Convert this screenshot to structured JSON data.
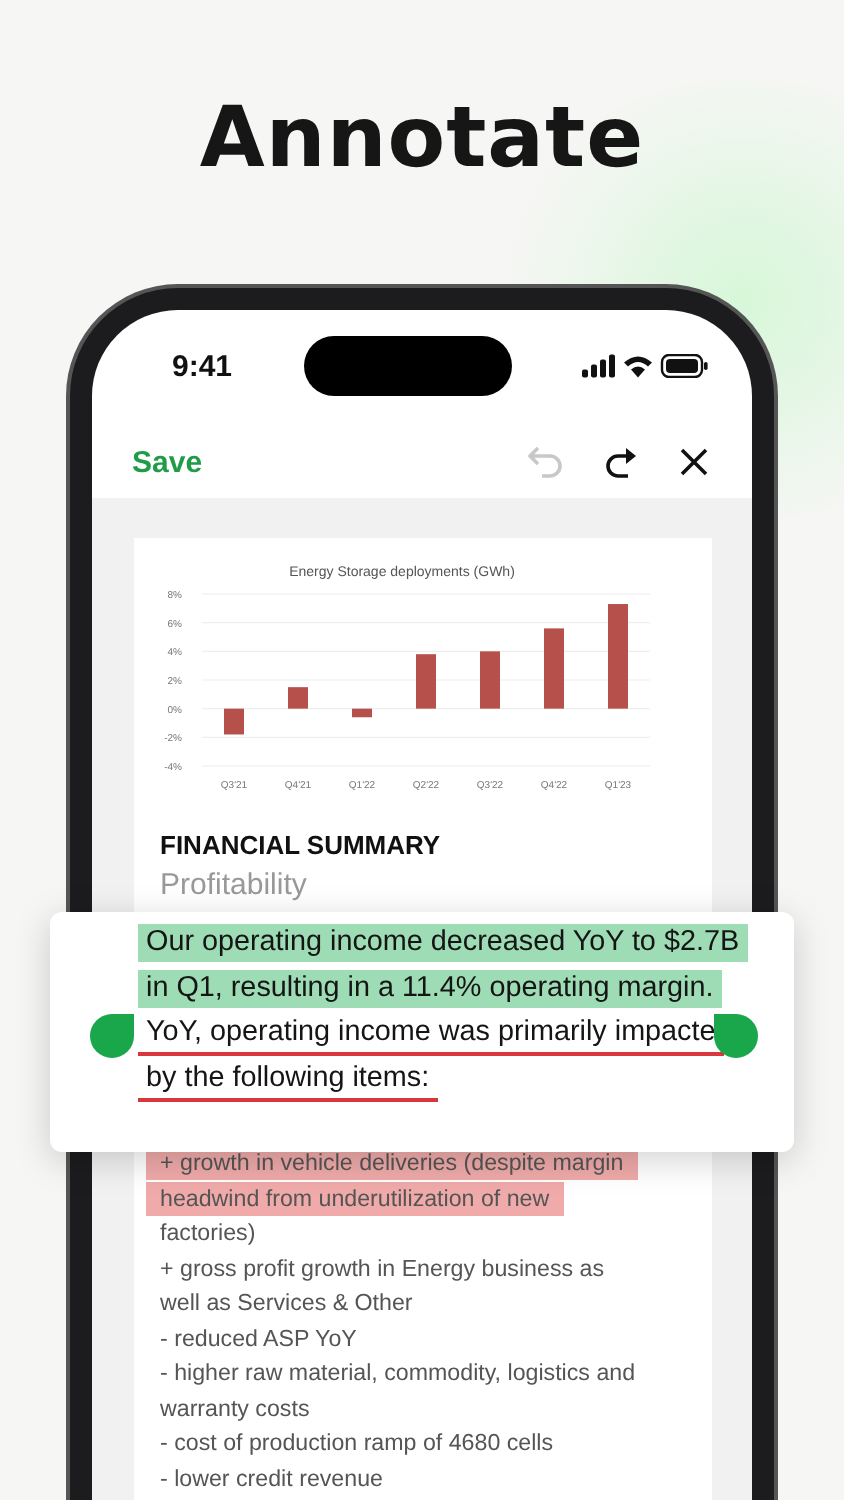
{
  "heading": "Annotate",
  "status_bar": {
    "time": "9:41"
  },
  "toolbar": {
    "save": "Save",
    "undo_disabled": true,
    "redo_disabled": false
  },
  "document": {
    "chart_data": {
      "type": "bar",
      "title": "Energy Storage deployments (GWh)",
      "categories": [
        "Q3'21",
        "Q4'21",
        "Q1'22",
        "Q2'22",
        "Q3'22",
        "Q4'22",
        "Q1'23"
      ],
      "grid": true,
      "series": [
        {
          "color": "#b5504b",
          "values": [
            -1.8,
            1.5,
            -0.6,
            3.8,
            4.0,
            5.6,
            7.3
          ]
        }
      ],
      "ylim": [
        -4,
        8
      ],
      "yticks": [
        {
          "value": 8,
          "label": "8%"
        },
        {
          "value": 6,
          "label": "6%"
        },
        {
          "value": 4,
          "label": "4%"
        },
        {
          "value": 2,
          "label": "2%"
        },
        {
          "value": 0,
          "label": "0%"
        },
        {
          "value": -2,
          "label": "-2%"
        },
        {
          "value": -4,
          "label": "-4%"
        }
      ]
    },
    "section_title": "FINANCIAL SUMMARY",
    "subtitle": "Profitability",
    "popup_lines": [
      {
        "text": "Our operating income decreased YoY to $2.7B",
        "kind": "highlight",
        "color": "#9ddcb5"
      },
      {
        "text": "in Q1, resulting in a 11.4% operating margin.",
        "kind": "highlight",
        "color": "#9ddcb5"
      },
      {
        "text": "YoY, operating income was primarily impacte",
        "kind": "underline",
        "color": "#d9363e"
      },
      {
        "text": "by the following items:",
        "kind": "underline",
        "color": "#d9363e"
      }
    ],
    "lines": [
      {
        "text": "+ growth in vehicle deliveries (despite margin",
        "kind": "highlight",
        "color": "#efaaa9"
      },
      {
        "text": "headwind from underutilization of new",
        "kind": "highlight",
        "color": "#efaaa9"
      },
      {
        "text": "factories)",
        "kind": "plain"
      },
      {
        "text": "+ gross profit growth in Energy business as",
        "kind": "plain"
      },
      {
        "text": "well as Services & Other",
        "kind": "plain"
      },
      {
        "text": "- reduced ASP YoY",
        "kind": "plain"
      },
      {
        "text": "- higher raw material, commodity, logistics and",
        "kind": "plain"
      },
      {
        "text": "warranty costs",
        "kind": "plain"
      },
      {
        "text": "- cost of production ramp of 4680 cells",
        "kind": "plain"
      },
      {
        "text": "- lower credit revenue",
        "kind": "plain"
      }
    ]
  }
}
